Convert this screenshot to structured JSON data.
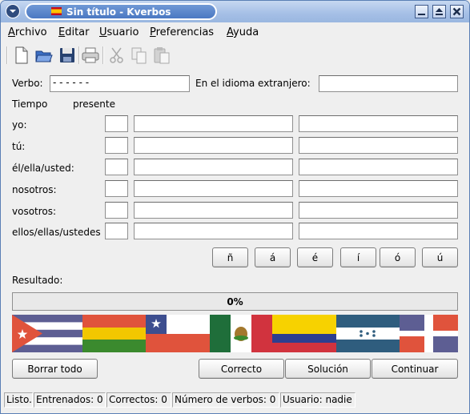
{
  "window": {
    "title": "Sin título - Kverbos"
  },
  "menu": {
    "items": [
      {
        "label": "Archivo",
        "mnemonic": "A",
        "rest": "rchivo"
      },
      {
        "label": "Editar",
        "mnemonic": "E",
        "rest": "ditar"
      },
      {
        "label": "Usuario",
        "mnemonic": "U",
        "rest": "suario"
      },
      {
        "label": "Preferencias",
        "mnemonic": "P",
        "rest": "referencias"
      },
      {
        "label": "Ayuda",
        "mnemonic": "A",
        "rest": "yuda"
      }
    ]
  },
  "toolbar": {
    "icons": [
      "new-document-icon",
      "open-folder-icon",
      "save-disk-icon",
      "print-icon",
      "cut-icon",
      "copy-icon",
      "paste-icon"
    ]
  },
  "form": {
    "verbo_label": "Verbo:",
    "verbo_value": "- - - - - -",
    "foreign_label": "En el idioma extranjero:",
    "foreign_value": "",
    "tiempo_label": "Tiempo",
    "tiempo_value": "presente",
    "persons": [
      {
        "label": "yo:"
      },
      {
        "label": "tú:"
      },
      {
        "label": "él/ella/usted:"
      },
      {
        "label": "nosotros:"
      },
      {
        "label": "vosotros:"
      },
      {
        "label": "ellos/ellas/ustedes:"
      }
    ],
    "accent_buttons": [
      "ñ",
      "á",
      "é",
      "í",
      "ó",
      "ú"
    ],
    "resultado_label": "Resultado:"
  },
  "progress": {
    "value": 0,
    "text": "0%"
  },
  "buttons": {
    "borrar": "Borrar todo",
    "correcto": "Correcto",
    "solucion": "Solución",
    "continuar": "Continuar"
  },
  "status": {
    "ready": "Listo.",
    "trained": "Entrenados: 0",
    "correct": "Correctos: 0",
    "verbs": "Número de verbos: 0",
    "user": "Usuario: nadie"
  },
  "flags": [
    "cuba-flag",
    "bolivia-flag",
    "chile-flag",
    "mexico-flag",
    "colombia-flag",
    "honduras-flag",
    "dominican-republic-flag"
  ]
}
